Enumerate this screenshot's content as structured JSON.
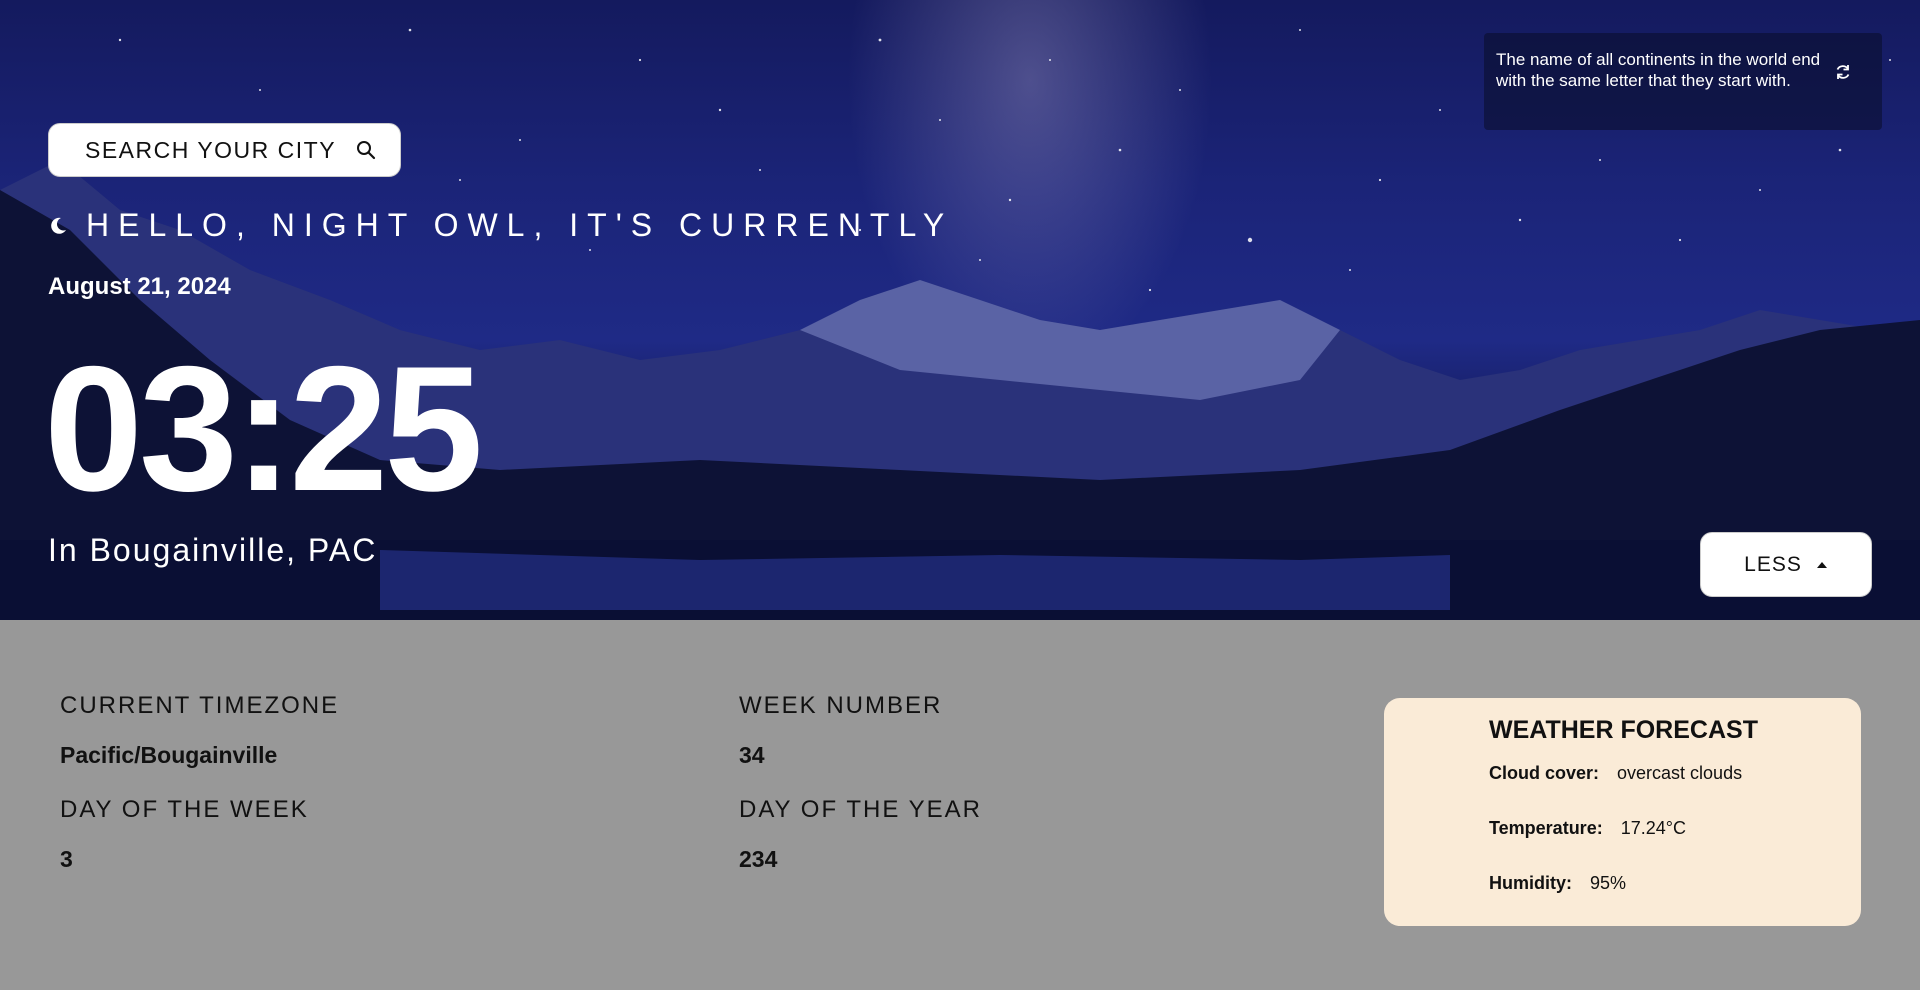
{
  "search": {
    "label": "SEARCH YOUR CITY",
    "icon": "search-icon"
  },
  "greeting": {
    "text": "HELLO, NIGHT OWL, IT'S CURRENTLY",
    "icon": "moon-icon"
  },
  "date": "August 21, 2024",
  "time": "03:25",
  "location": "In Bougainville, PAC",
  "quote": {
    "text": "The name of all continents in the world end with the same letter that they start with.",
    "icon": "refresh-icon"
  },
  "toggle": {
    "label": "LESS",
    "icon": "caret-up-icon"
  },
  "details": {
    "timezone_label": "CURRENT TIMEZONE",
    "timezone_value": "Pacific/Bougainville",
    "day_of_week_label": "DAY OF THE WEEK",
    "day_of_week_value": "3",
    "week_number_label": "WEEK NUMBER",
    "week_number_value": "34",
    "day_of_year_label": "DAY OF THE YEAR",
    "day_of_year_value": "234"
  },
  "weather": {
    "title": "WEATHER FORECAST",
    "cloud_label": "Cloud cover:",
    "cloud_value": "overcast clouds",
    "temp_label": "Temperature:",
    "temp_value": "17.24°C",
    "humidity_label": "Humidity:",
    "humidity_value": "95%"
  },
  "colors": {
    "details_background": "#989898",
    "weather_card": "#faebd7",
    "sky": "#1b2478"
  }
}
